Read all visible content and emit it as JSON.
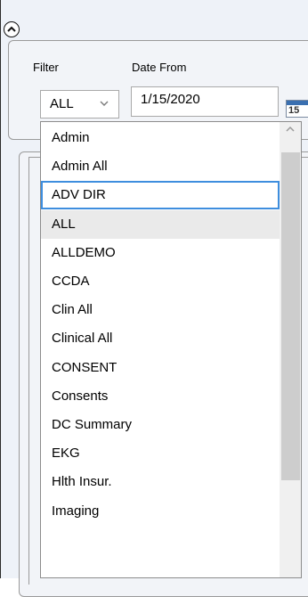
{
  "filters": {
    "filter_label": "Filter",
    "date_from_label": "Date From",
    "filter_value": "ALL",
    "date_from_value": "1/15/2020",
    "calendar_day": "15"
  },
  "dropdown": {
    "items": [
      {
        "label": "Admin",
        "state": "normal"
      },
      {
        "label": "Admin All",
        "state": "normal"
      },
      {
        "label": "ADV DIR",
        "state": "focused"
      },
      {
        "label": "ALL",
        "state": "selected"
      },
      {
        "label": "ALLDEMO",
        "state": "normal"
      },
      {
        "label": "CCDA",
        "state": "normal"
      },
      {
        "label": "Clin All",
        "state": "normal"
      },
      {
        "label": "Clinical All",
        "state": "normal"
      },
      {
        "label": "CONSENT",
        "state": "normal"
      },
      {
        "label": "Consents",
        "state": "normal"
      },
      {
        "label": "DC Summary",
        "state": "normal"
      },
      {
        "label": "EKG",
        "state": "normal"
      },
      {
        "label": "Hlth Insur.",
        "state": "normal"
      },
      {
        "label": "Imaging",
        "state": "normal"
      }
    ]
  },
  "colors": {
    "focus_border": "#3e8ede",
    "selected_bg": "#eaeaea",
    "panel_bg": "#eef2f8"
  }
}
